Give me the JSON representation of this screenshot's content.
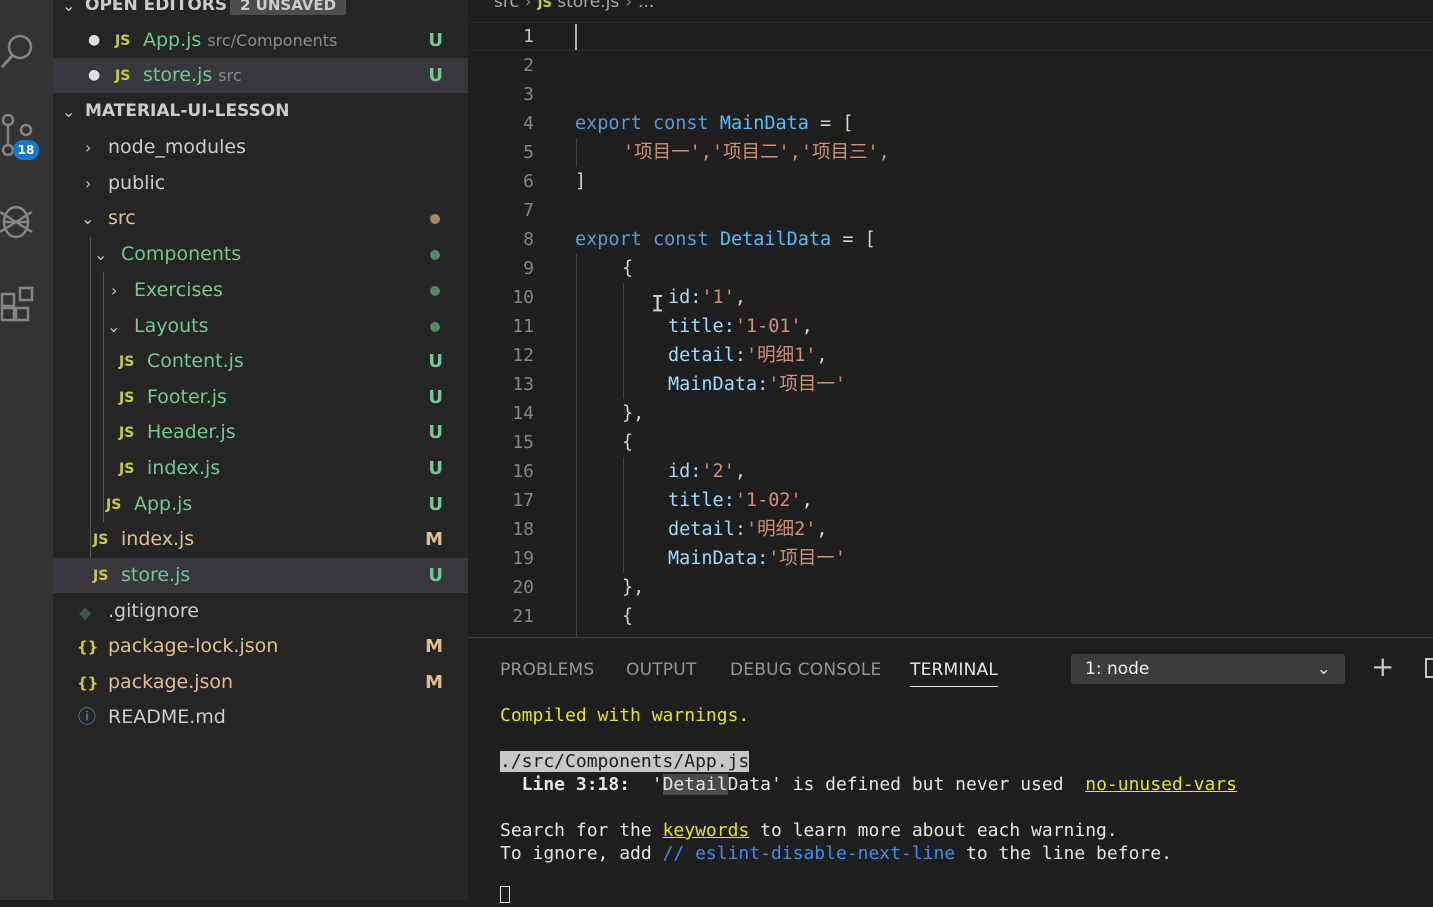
{
  "activity_bar": {
    "icons": [
      "search-icon",
      "source-control-icon",
      "debug-icon",
      "extensions-icon"
    ],
    "source_control_badge": "18"
  },
  "explorer": {
    "open_editors_label": "OPEN EDITORS",
    "unsaved_label": "2 UNSAVED",
    "open_editors": [
      {
        "name": "App.js",
        "path": "src/Components",
        "status": "U"
      },
      {
        "name": "store.js",
        "path": "src",
        "status": "U"
      }
    ],
    "project_label": "MATERIAL-UI-LESSON",
    "tree": [
      {
        "name": "node_modules",
        "type": "folder"
      },
      {
        "name": "public",
        "type": "folder"
      },
      {
        "name": "src",
        "type": "folder"
      },
      {
        "name": "Components",
        "type": "folder"
      },
      {
        "name": "Exercises",
        "type": "folder"
      },
      {
        "name": "Layouts",
        "type": "folder"
      },
      {
        "name": "Content.js",
        "type": "js",
        "status": "U"
      },
      {
        "name": "Footer.js",
        "type": "js",
        "status": "U"
      },
      {
        "name": "Header.js",
        "type": "js",
        "status": "U"
      },
      {
        "name": "index.js",
        "type": "js",
        "status": "U"
      },
      {
        "name": "App.js",
        "type": "js",
        "status": "U"
      },
      {
        "name": "index.js",
        "type": "js",
        "status": "M"
      },
      {
        "name": "store.js",
        "type": "js",
        "status": "U"
      },
      {
        "name": ".gitignore",
        "type": "git"
      },
      {
        "name": "package-lock.json",
        "type": "json",
        "status": "M"
      },
      {
        "name": "package.json",
        "type": "json",
        "status": "M"
      },
      {
        "name": "README.md",
        "type": "info"
      }
    ]
  },
  "breadcrumbs": {
    "folder": "src",
    "file": "store.js",
    "more": "..."
  },
  "editor": {
    "line_numbers": [
      "1",
      "2",
      "3",
      "4",
      "5",
      "6",
      "7",
      "8",
      "9",
      "10",
      "11",
      "12",
      "13",
      "14",
      "15",
      "16",
      "17",
      "18",
      "19",
      "20",
      "21"
    ],
    "tokens": {
      "export": "export",
      "const": "const",
      "main_data": "MainData",
      "detail_data": "DetailData",
      "eq_bracket": " = [",
      "close_bracket": "]",
      "items": "'项目一','项目二','项目三',",
      "open_brace": "{",
      "close_brace_comma": "},",
      "id_key": "id:",
      "title_key": "title:",
      "detail_key": "detail:",
      "main_key": "MainData:",
      "id1": "'1'",
      "title1": "'1-01'",
      "detail1": "'明细1'",
      "main1": "'项目一'",
      "id2": "'2'",
      "title2": "'1-02'",
      "detail2": "'明细2'",
      "main2": "'项目一'",
      "comma": ","
    }
  },
  "panel": {
    "tabs": [
      "PROBLEMS",
      "OUTPUT",
      "DEBUG CONSOLE",
      "TERMINAL"
    ],
    "active_tab": "TERMINAL",
    "terminal_select": "1: node",
    "terminal": {
      "compiled": "Compiled with warnings.",
      "file": "./src/Components/App.js",
      "line_prefix": "  Line 3:18:  ",
      "quote_open": "'",
      "detail_hl": "Detail",
      "detail_rest": "Data",
      "warn_msg": "' is defined but never used  ",
      "rule": "no-unused-vars",
      "search_a": "Search for the ",
      "keywords": "keywords",
      "search_b": " to learn more about each warning.",
      "ignore_a": "To ignore, add ",
      "disable": "// eslint-disable-next-line",
      "ignore_b": " to the line before."
    }
  }
}
